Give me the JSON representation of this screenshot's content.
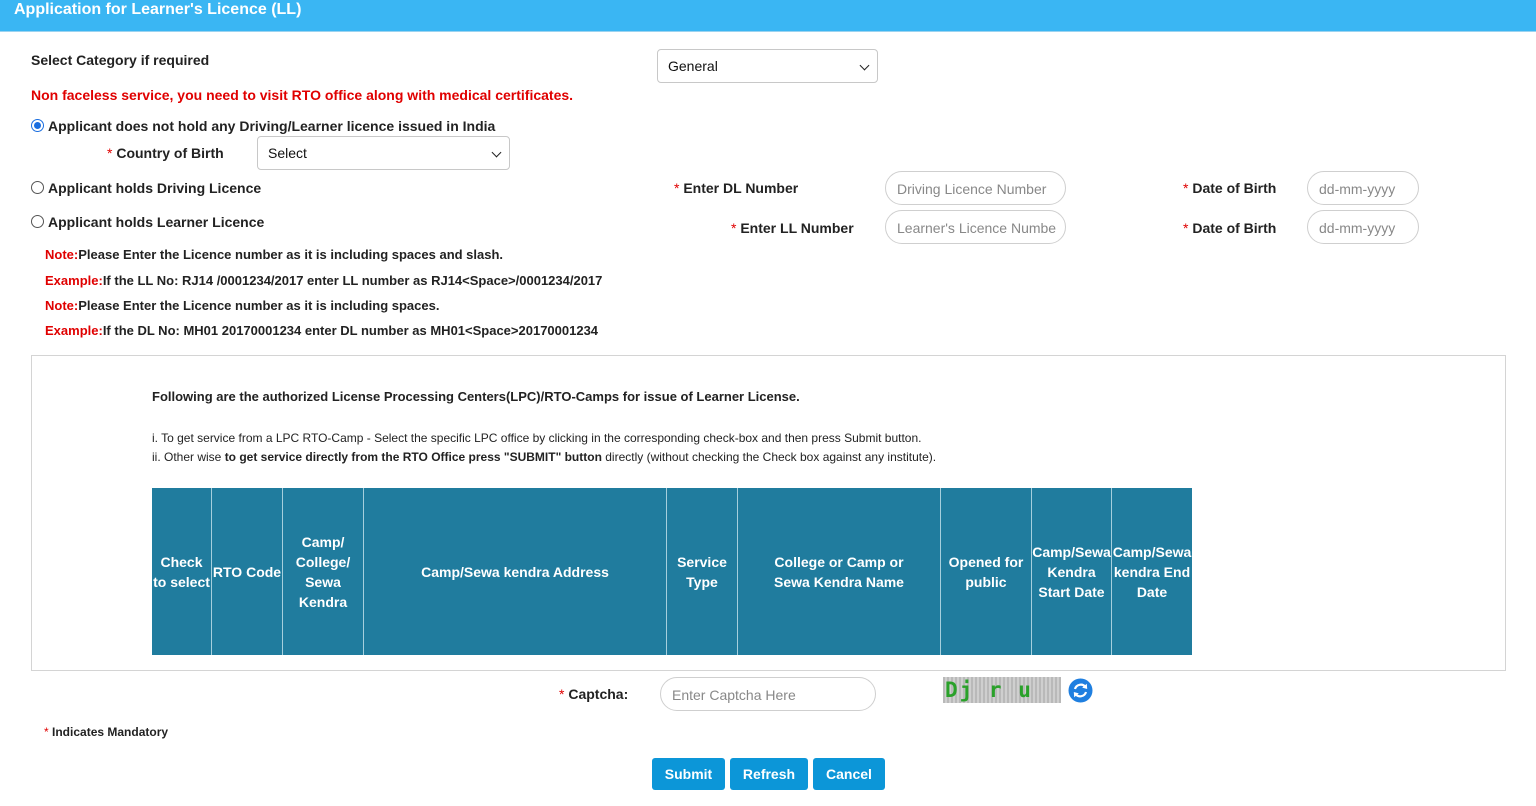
{
  "header": {
    "title": "Application for Learner's Licence (LL)"
  },
  "category": {
    "label": "Select Category if required",
    "selected": "General"
  },
  "warning": "Non faceless service, you need to visit RTO office along with medical certificates.",
  "options": {
    "no_licence": {
      "label": "Applicant does not hold any Driving/Learner licence issued in India",
      "checked": true
    },
    "driving_licence": {
      "label": "Applicant holds Driving Licence",
      "checked": false
    },
    "learner_licence": {
      "label": "Applicant holds Learner Licence",
      "checked": false
    }
  },
  "country": {
    "label": "Country of Birth",
    "selected": "Select"
  },
  "dl": {
    "label": "Enter DL Number",
    "placeholder": "Driving Licence Number",
    "dob_label": "Date of Birth",
    "dob_placeholder": "dd-mm-yyyy"
  },
  "ll": {
    "label": "Enter LL Number",
    "placeholder": "Learner's Licence Numbe",
    "dob_label": "Date of Birth",
    "dob_placeholder": "dd-mm-yyyy"
  },
  "notes": [
    {
      "prefix": "Note:",
      "text": "Please Enter the Licence number as it is including spaces and slash."
    },
    {
      "prefix": "Example:",
      "text": "If the LL No: RJ14 /0001234/2017 enter LL number as RJ14<Space>/0001234/2017"
    },
    {
      "prefix": "Note:",
      "text": "Please Enter the Licence number as it is including spaces."
    },
    {
      "prefix": "Example:",
      "text": "If the DL No: MH01 20170001234 enter DL number as MH01<Space>20170001234"
    }
  ],
  "lpc": {
    "heading": "Following are the authorized License Processing Centers(LPC)/RTO-Camps for issue of Learner License.",
    "line1": "i. To get service from a LPC RTO-Camp - Select the specific LPC office by clicking in the corresponding check-box and then press Submit button.",
    "line2_prefix": "ii. Other wise ",
    "line2_bold": "to get service directly from the RTO Office press \"SUBMIT\" button",
    "line2_suffix": " directly (without checking the Check box against any institute).",
    "columns": [
      "Check to select",
      "RTO Code",
      "Camp/ College/ Sewa Kendra",
      "Camp/Sewa kendra Address",
      "Service Type",
      "College or Camp or Sewa Kendra Name",
      "Opened for public",
      "Camp/Sewa Kendra Start Date",
      "Camp/Sewa kendra End Date"
    ]
  },
  "captcha": {
    "label": "Captcha:",
    "placeholder": "Enter Captcha Here",
    "image_text": "Dj r u m U"
  },
  "mandatory_note": "Indicates Mandatory",
  "required_mark": "*",
  "buttons": {
    "submit": "Submit",
    "refresh": "Refresh",
    "cancel": "Cancel"
  },
  "colors": {
    "header": "#3ab6f3",
    "table_header": "#207c9e",
    "button": "#0c96d8",
    "required": "#e00000"
  }
}
